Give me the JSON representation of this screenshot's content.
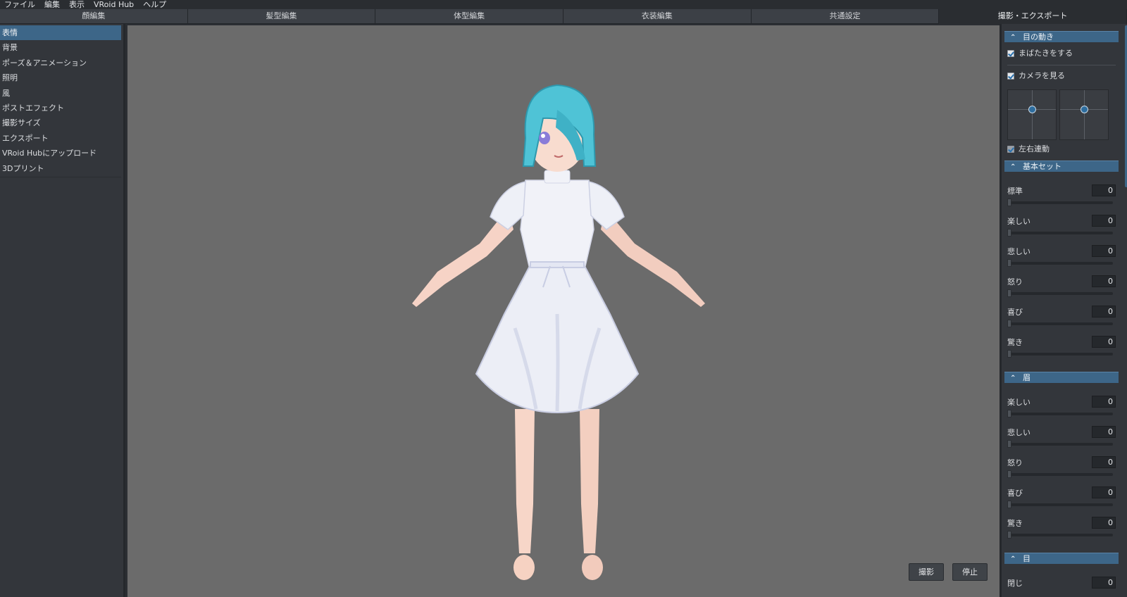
{
  "menubar": {
    "items": [
      "ファイル",
      "編集",
      "表示",
      "VRoid Hub",
      "ヘルプ"
    ]
  },
  "tabs": [
    {
      "label": "顔編集",
      "active": false
    },
    {
      "label": "髪型編集",
      "active": false
    },
    {
      "label": "体型編集",
      "active": false
    },
    {
      "label": "衣装編集",
      "active": false
    },
    {
      "label": "共通設定",
      "active": false
    },
    {
      "label": "撮影・エクスポート",
      "active": true
    }
  ],
  "sidebar": {
    "items": [
      {
        "label": "表情",
        "selected": true
      },
      {
        "label": "背景",
        "selected": false
      },
      {
        "label": "ポーズ＆アニメーション",
        "selected": false
      },
      {
        "label": "照明",
        "selected": false
      },
      {
        "label": "風",
        "selected": false
      },
      {
        "label": "ポストエフェクト",
        "selected": false
      },
      {
        "label": "撮影サイズ",
        "selected": false
      },
      {
        "label": "エクスポート",
        "selected": false
      },
      {
        "label": "VRoid Hubにアップロード",
        "selected": false
      },
      {
        "label": "3Dプリント",
        "selected": false
      }
    ]
  },
  "viewport": {
    "shoot_label": "撮影",
    "stop_label": "停止"
  },
  "panel": {
    "eye_motion": {
      "title": "目の動き",
      "blink_label": "まばたきをする",
      "blink_checked": true,
      "look_camera_label": "カメラを見る",
      "look_camera_checked": true,
      "sync_label": "左右連動",
      "sync_checked": true
    },
    "basic_set": {
      "title": "基本セット",
      "sliders": [
        {
          "label": "標準",
          "value": "0"
        },
        {
          "label": "楽しい",
          "value": "0"
        },
        {
          "label": "悲しい",
          "value": "0"
        },
        {
          "label": "怒り",
          "value": "0"
        },
        {
          "label": "喜び",
          "value": "0"
        },
        {
          "label": "驚き",
          "value": "0"
        }
      ]
    },
    "brow": {
      "title": "眉",
      "sliders": [
        {
          "label": "楽しい",
          "value": "0"
        },
        {
          "label": "悲しい",
          "value": "0"
        },
        {
          "label": "怒り",
          "value": "0"
        },
        {
          "label": "喜び",
          "value": "0"
        },
        {
          "label": "驚き",
          "value": "0"
        }
      ]
    },
    "eye": {
      "title": "目",
      "first_label": "閉じ",
      "first_value": "0"
    }
  },
  "colors": {
    "accent": "#3d6688",
    "viewport_bg": "#6b6b6b",
    "hair": "#4fc3d6",
    "dress": "#eceef6"
  },
  "icons": {
    "collapse": "chevron-up-icon",
    "check": "checkmark-icon"
  }
}
